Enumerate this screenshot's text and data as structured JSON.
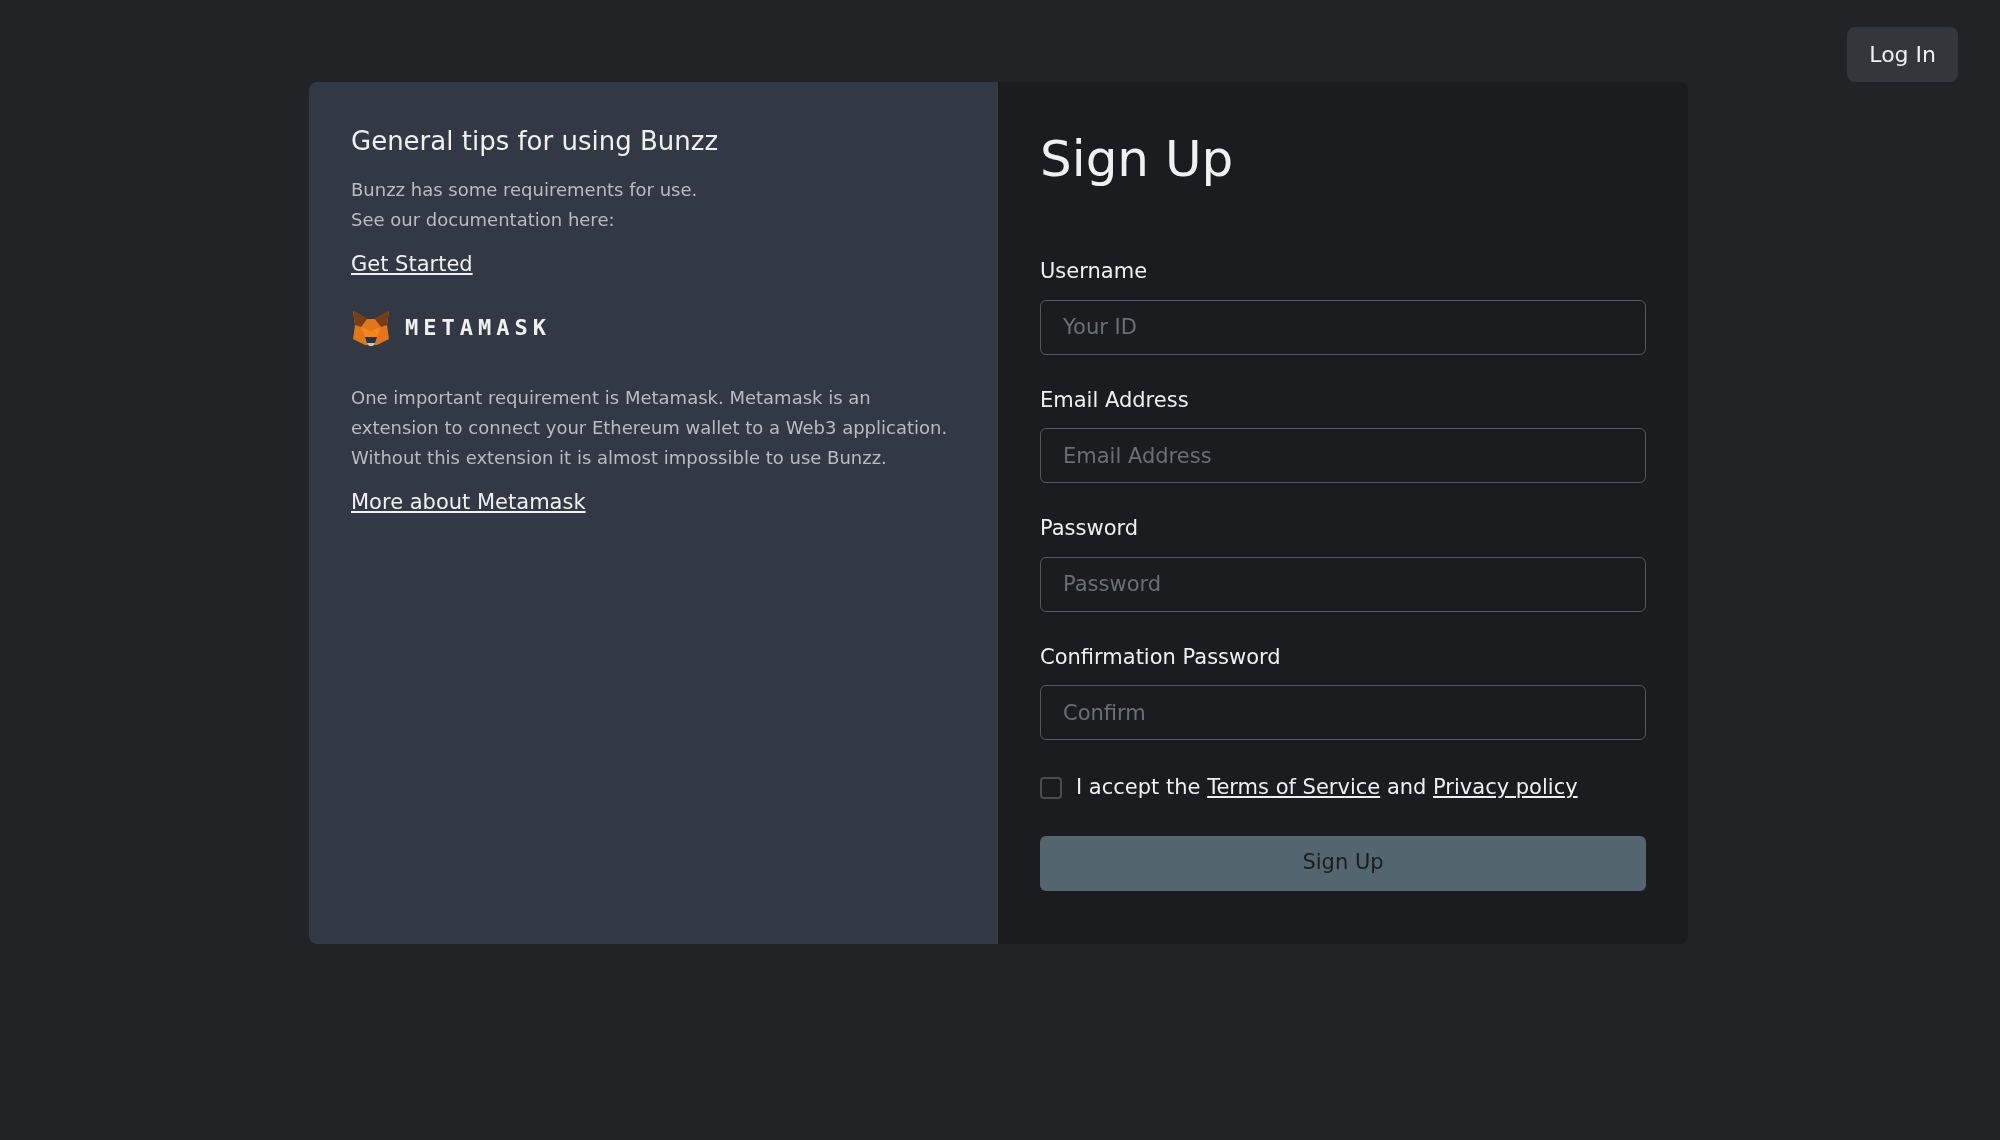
{
  "header": {
    "login_button": "Log In"
  },
  "tips": {
    "title": "General tips for using Bunzz",
    "intro_lines": [
      "Bunzz has some requirements for use.",
      "See our documentation here:"
    ],
    "get_started_link": "Get Started",
    "logo_wordmark": "METAMASK",
    "description": "One important requirement is Metamask. Metamask is an extension to connect your Ethereum wallet to a Web3 application. Without this extension it is almost impossible to use Bunzz.",
    "more_link": "More about Metamask"
  },
  "form": {
    "title": "Sign Up",
    "fields": [
      {
        "label": "Username",
        "placeholder": "Your ID"
      },
      {
        "label": "Email Address",
        "placeholder": "Email Address"
      },
      {
        "label": "Password",
        "placeholder": "Password"
      },
      {
        "label": "Confirmation Password",
        "placeholder": "Confirm"
      }
    ],
    "consent": {
      "checked": false,
      "prefix": "I accept the",
      "terms_link": "Terms of Service",
      "joiner": "and",
      "privacy_link": "Privacy policy"
    },
    "submit": {
      "label": "Sign Up",
      "disabled": true
    }
  }
}
